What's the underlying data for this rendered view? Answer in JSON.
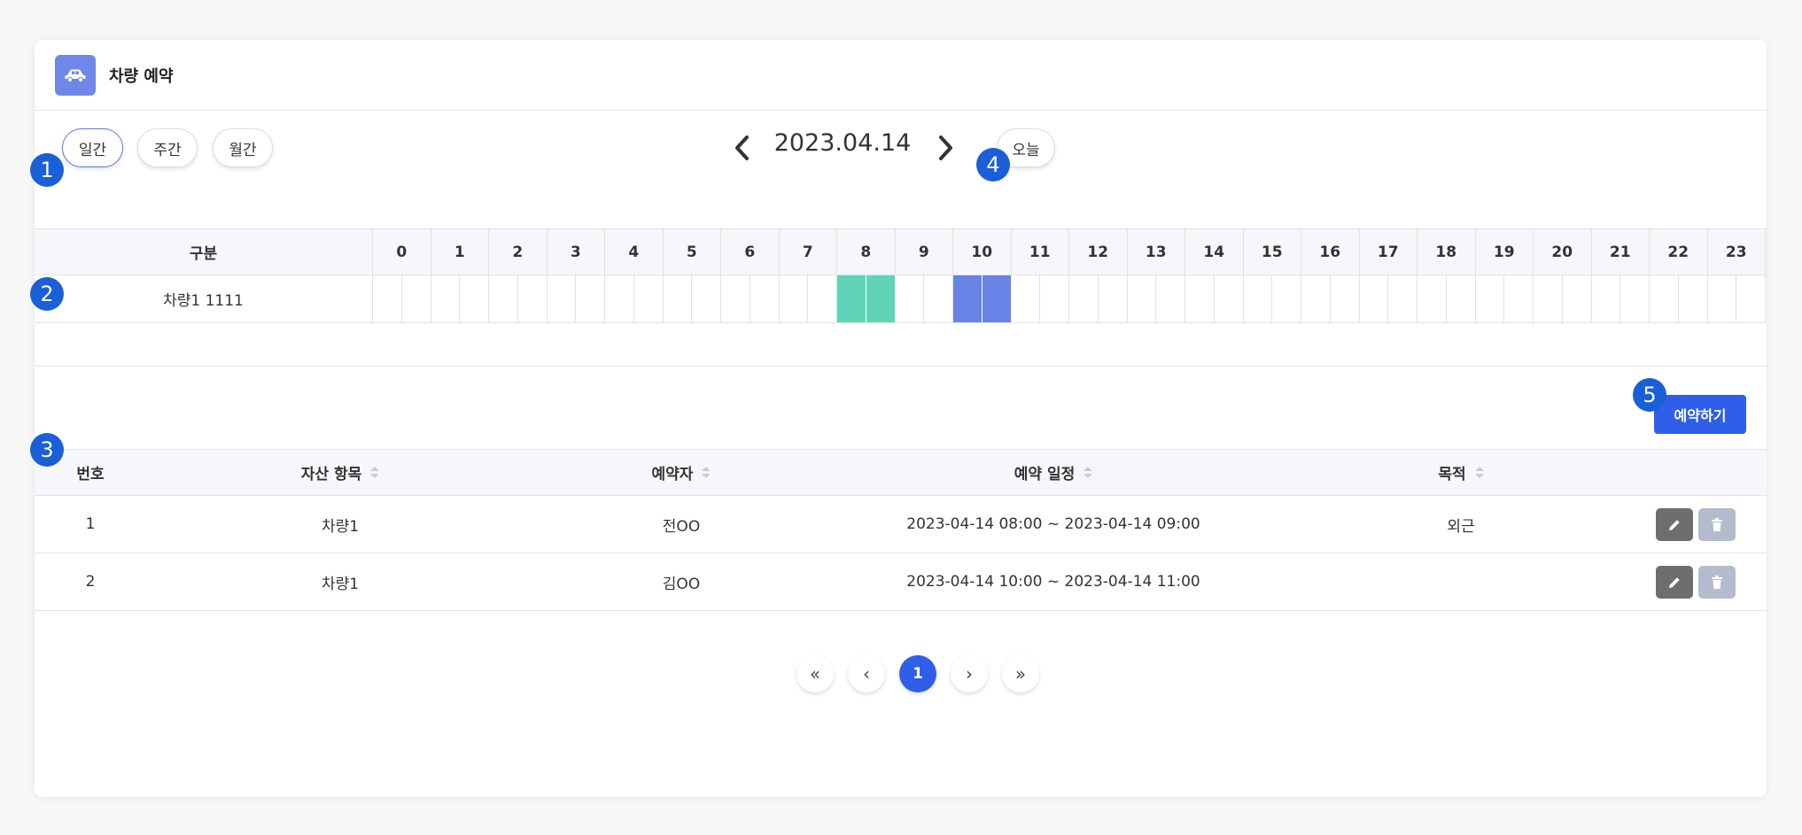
{
  "header": {
    "title": "차량 예약",
    "icon": "car-icon"
  },
  "view_tabs": [
    {
      "label": "일간",
      "active": true
    },
    {
      "label": "주간",
      "active": false
    },
    {
      "label": "월간",
      "active": false
    }
  ],
  "date_nav": {
    "date": "2023.04.14",
    "today_label": "오늘"
  },
  "badges": [
    "1",
    "2",
    "3",
    "4",
    "5"
  ],
  "timeline": {
    "header_label": "구분",
    "hours": [
      "0",
      "1",
      "2",
      "3",
      "4",
      "5",
      "6",
      "7",
      "8",
      "9",
      "10",
      "11",
      "12",
      "13",
      "14",
      "15",
      "16",
      "17",
      "18",
      "19",
      "20",
      "21",
      "22",
      "23"
    ],
    "rows": [
      {
        "label": "차량1 1111",
        "bookings": [
          {
            "start": 8.0,
            "end": 9.0,
            "color": "#5fd4b9"
          },
          {
            "start": 10.0,
            "end": 11.0,
            "color": "#6783e6"
          }
        ]
      }
    ]
  },
  "reserve_button": "예약하기",
  "table": {
    "columns": [
      "번호",
      "자산 항목",
      "예약자",
      "예약 일정",
      "목적"
    ],
    "rows": [
      {
        "no": "1",
        "asset": "차량1",
        "booker": "전OO",
        "schedule": "2023-04-14 08:00 ~ 2023-04-14 09:00",
        "purpose": "외근"
      },
      {
        "no": "2",
        "asset": "차량1",
        "booker": "김OO",
        "schedule": "2023-04-14 10:00 ~ 2023-04-14 11:00",
        "purpose": ""
      }
    ]
  },
  "pagination": {
    "first": "«",
    "prev": "‹",
    "current": "1",
    "next": "›",
    "last": "»"
  },
  "colors": {
    "accent": "#2f5fe8",
    "badge": "#1a5ed8",
    "booking_green": "#5fd4b9",
    "booking_blue": "#6783e6"
  }
}
